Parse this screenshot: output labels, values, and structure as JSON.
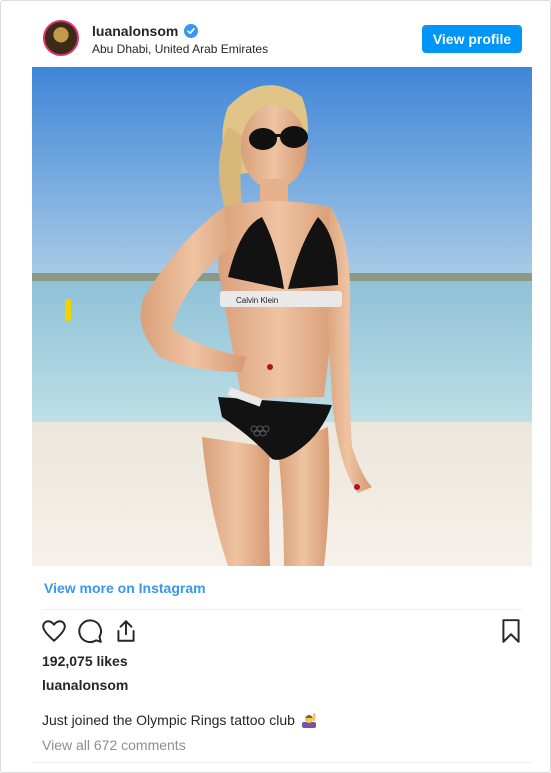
{
  "header": {
    "username": "luanalonsom",
    "location": "Abu Dhabi, United Arab Emirates",
    "view_profile_label": "View profile",
    "verified_icon": "verified-badge-icon"
  },
  "photo": {
    "brand_text": "Calvin Klein"
  },
  "view_more_label": "View more on Instagram",
  "actions": {
    "icons": [
      "heart-icon",
      "comment-icon",
      "share-icon",
      "bookmark-icon"
    ]
  },
  "likes_text": "192,075 likes",
  "owner_text": "luanalonsom",
  "caption": {
    "text": "Just joined the Olympic Rings tattoo club",
    "emoji": "woman-raising-hand-emoji"
  },
  "comments_link": "View all 672 comments",
  "colors": {
    "accent": "#0095f6",
    "link": "#3897f0",
    "text": "#262626",
    "muted": "#8e8e8e"
  }
}
